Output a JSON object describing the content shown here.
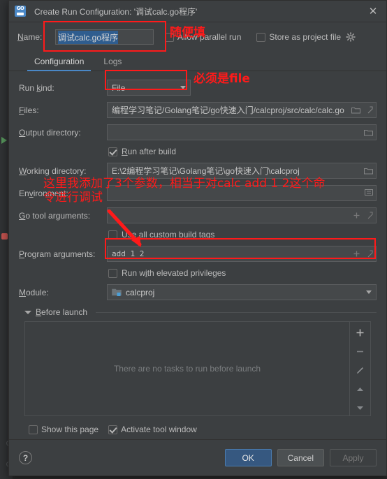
{
  "window": {
    "app_icon": "goland-go-icon",
    "title": "Create Run Configuration: '调试calc.go程序'",
    "close_icon": "close-icon"
  },
  "name_row": {
    "label": "Name:",
    "value": "调试calc.go程序",
    "allow_parallel_label": "Allow parallel run",
    "allow_parallel_checked": false,
    "store_as_project_file_label": "Store as project file",
    "store_as_project_file_checked": false,
    "gear_icon": "gear-icon"
  },
  "tabs": [
    {
      "label": "Configuration",
      "active": true
    },
    {
      "label": "Logs",
      "active": false
    }
  ],
  "form": {
    "run_kind": {
      "label": "Run kind:",
      "value": "File"
    },
    "files": {
      "label": "Files:",
      "value": "编程学习笔记/Golang笔记/go快速入门/calcproj/src/calc/calc.go",
      "folder_icon": "folder-icon",
      "expand_icon": "expand-icon"
    },
    "output_directory": {
      "label": "Output directory:",
      "value": "",
      "folder_icon": "folder-icon"
    },
    "run_after_build": {
      "label": "Run after build",
      "checked": true
    },
    "working_directory": {
      "label": "Working directory:",
      "value": "E:\\2编程学习笔记\\Golang笔记\\go快速入门\\calcproj",
      "folder_icon": "folder-icon"
    },
    "environment": {
      "label": "Environment:",
      "value": "",
      "browse_icon": "browse-icon"
    },
    "go_tool_arguments": {
      "label": "Go tool arguments:",
      "value": "",
      "plus_icon": "plus-icon",
      "expand_icon": "expand-icon"
    },
    "use_all_custom_build_tags": {
      "label": "Use all custom build tags",
      "checked": false
    },
    "program_arguments": {
      "label": "Program arguments:",
      "value": "add 1 2",
      "plus_icon": "plus-icon",
      "expand_icon": "expand-icon"
    },
    "run_with_elevated_privileges": {
      "label": "Run with elevated privileges",
      "checked": false
    },
    "module": {
      "label": "Module:",
      "value": "calcproj",
      "module_icon": "module-folder-icon"
    }
  },
  "before_launch": {
    "title": "Before launch",
    "empty_text": "There are no tasks to run before launch",
    "toolbar": [
      "plus-icon",
      "minus-icon",
      "pencil-icon",
      "arrow-up-icon",
      "arrow-down-icon"
    ]
  },
  "footer": {
    "show_this_page": {
      "label": "Show this page",
      "checked": false
    },
    "activate_tool_window": {
      "label": "Activate tool window",
      "checked": true
    },
    "help_label": "?",
    "ok_label": "OK",
    "cancel_label": "Cancel",
    "apply_label": "Apply"
  },
  "annotations": {
    "name_note": "随便填",
    "run_kind_note": "必须是file",
    "env_note": "这里我添加了3个参数，相当于对calc add 1 2这个命\n令进行调试",
    "color": "#ff1a1a"
  },
  "colors": {
    "dialog_bg": "#3c3f41",
    "field_bg": "#45484a",
    "accent_blue": "#4a88c7",
    "ok_button": "#365880",
    "annotation_red": "#ff1a1a",
    "text": "#bbbbbb"
  }
}
